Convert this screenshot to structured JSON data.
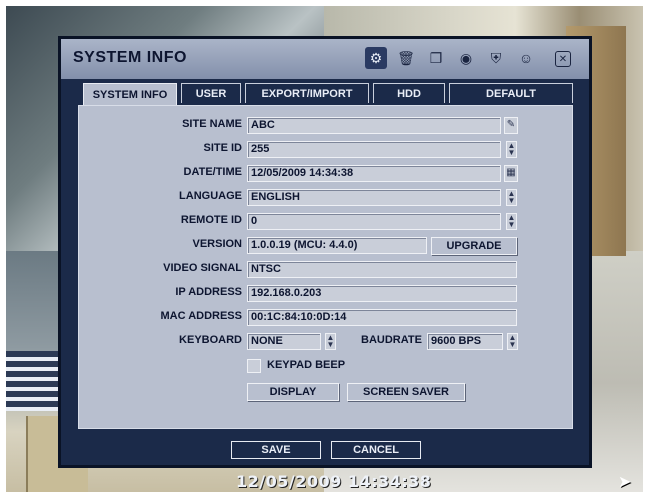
{
  "window": {
    "title": "SYSTEM INFO"
  },
  "toolbar": {
    "icons": [
      "gear-icon",
      "trash-icon",
      "copy-icon",
      "globe-icon",
      "shield-icon",
      "user-icon",
      "close-icon"
    ]
  },
  "tabs": [
    {
      "label": "SYSTEM INFO",
      "active": true
    },
    {
      "label": "USER",
      "active": false
    },
    {
      "label": "EXPORT/IMPORT",
      "active": false
    },
    {
      "label": "HDD",
      "active": false
    },
    {
      "label": "DEFAULT",
      "active": false
    }
  ],
  "form": {
    "site_name": {
      "label": "SITE NAME",
      "value": "ABC"
    },
    "site_id": {
      "label": "SITE ID",
      "value": "255"
    },
    "date_time": {
      "label": "DATE/TIME",
      "value": "12/05/2009 14:34:38"
    },
    "language": {
      "label": "LANGUAGE",
      "value": "ENGLISH"
    },
    "remote_id": {
      "label": "REMOTE ID",
      "value": "0"
    },
    "version": {
      "label": "VERSION",
      "value": "1.0.0.19 (MCU: 4.4.0)",
      "upgrade_label": "UPGRADE"
    },
    "video_signal": {
      "label": "VIDEO SIGNAL",
      "value": "NTSC"
    },
    "ip_address": {
      "label": "IP ADDRESS",
      "value": "192.168.0.203"
    },
    "mac_address": {
      "label": "MAC ADDRESS",
      "value": "00:1C:84:10:0D:14"
    },
    "keyboard": {
      "label": "KEYBOARD",
      "value": "NONE"
    },
    "baudrate": {
      "label": "BAUDRATE",
      "value": "9600 BPS"
    },
    "keypad_beep": {
      "label": "KEYPAD BEEP",
      "checked": false
    },
    "display_label": "DISPLAY",
    "screen_saver_label": "SCREEN SAVER"
  },
  "footer": {
    "save_label": "SAVE",
    "cancel_label": "CANCEL"
  },
  "osd": {
    "timestamp": "12/05/2009 14:34:38"
  },
  "colors": {
    "dialog_bg": "#1b2a49",
    "panel_bg": "#b8bfcf",
    "titlebar": "#8390ab"
  }
}
